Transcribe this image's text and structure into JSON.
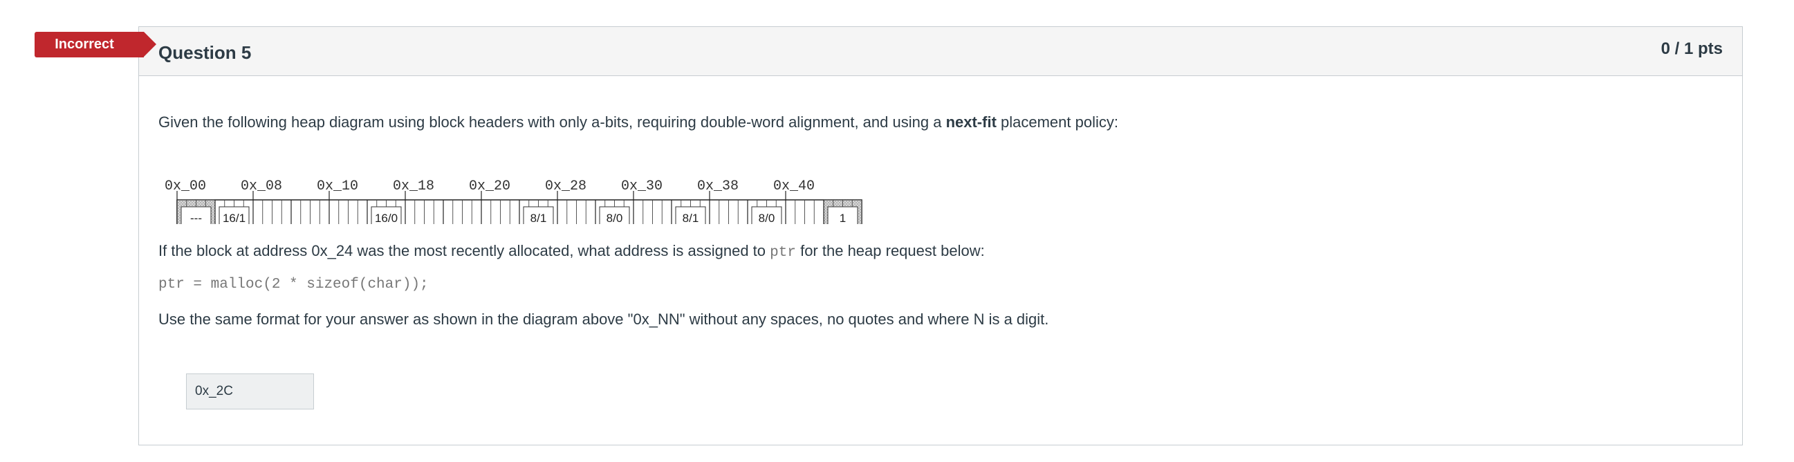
{
  "badge": {
    "label": "Incorrect",
    "color": "#c0272d"
  },
  "question": {
    "title": "Question 5",
    "points": "0 / 1 pts",
    "intro_before": "Given the following heap diagram using block headers with only a-bits, requiring double-word alignment, and using a ",
    "intro_bold": "next-fit",
    "intro_after": " placement policy:",
    "heap_addresses": [
      "0x_00",
      "0x_08",
      "0x_10",
      "0x_18",
      "0x_20",
      "0x_28",
      "0x_30",
      "0x_38",
      "0x_40"
    ],
    "heap_blocks": [
      {
        "label": "---",
        "word": 0,
        "shaded": true
      },
      {
        "label": "16/1",
        "word": 1,
        "shaded": false
      },
      {
        "label": "16/0",
        "word": 5,
        "shaded": false
      },
      {
        "label": "8/1",
        "word": 9,
        "shaded": false
      },
      {
        "label": "8/0",
        "word": 11,
        "shaded": false
      },
      {
        "label": "8/1",
        "word": 13,
        "shaded": false
      },
      {
        "label": "8/0",
        "word": 15,
        "shaded": false
      },
      {
        "label": "1",
        "word": 17,
        "shaded": true
      }
    ],
    "prompt_before": "If the block at address 0x_24 was the most recently allocated, what address is assigned to ",
    "prompt_code": "ptr",
    "prompt_after": " for the heap request below:",
    "code_line": "ptr = malloc(2 * sizeof(char));",
    "format_note": "Use the same format for your answer as shown in the diagram above \"0x_NN\" without any spaces, no quotes and where N is a digit.",
    "answer_value": "0x_2C"
  }
}
